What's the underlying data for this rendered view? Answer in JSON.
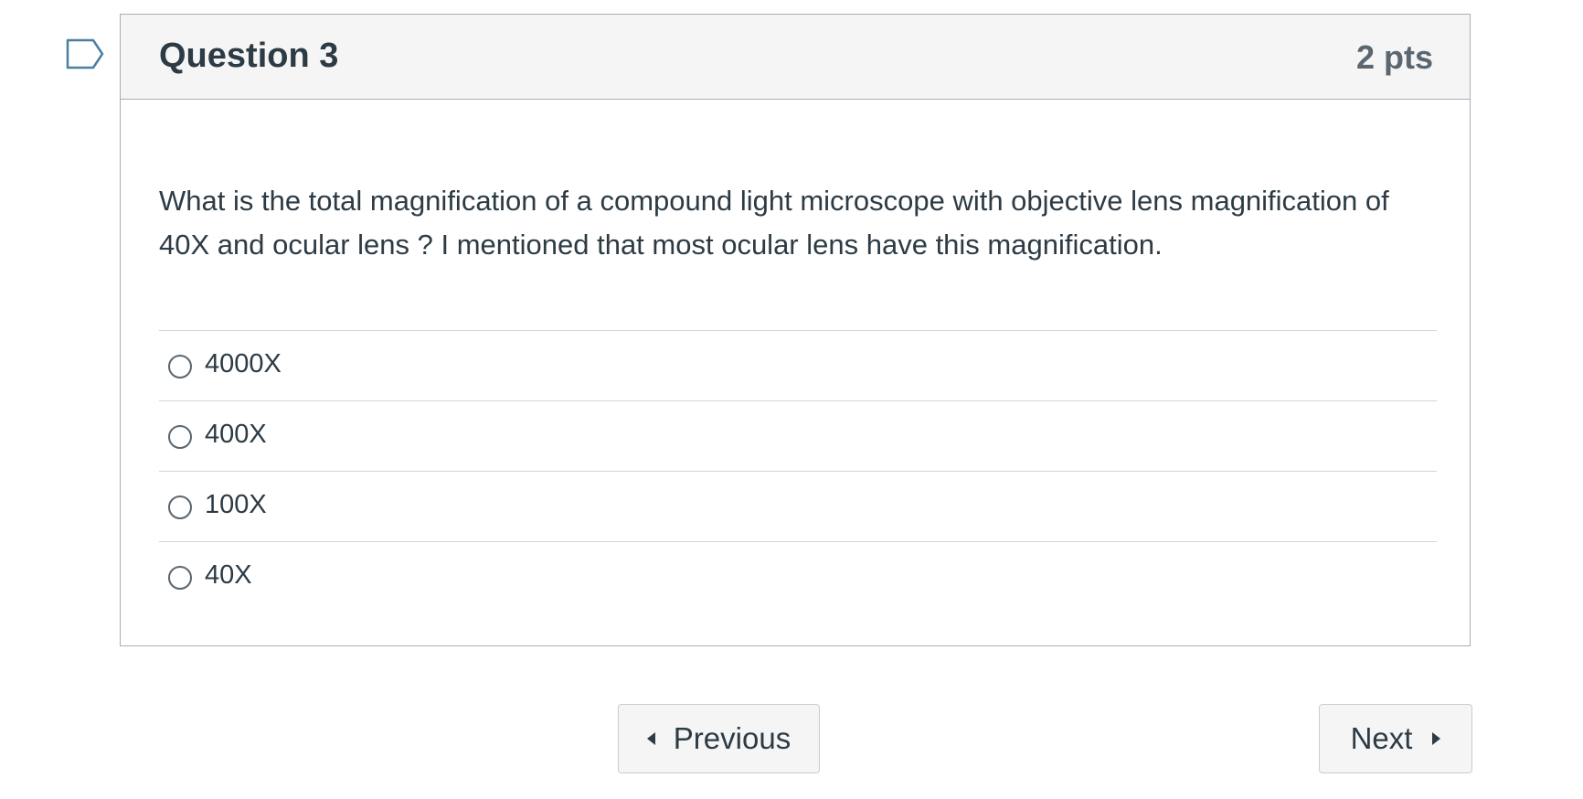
{
  "question": {
    "title": "Question 3",
    "points": "2 pts",
    "text": "What is the total magnification of a compound light microscope with objective lens magnification of 40X  and ocular lens ?  I mentioned that most ocular lens have this magnification.",
    "answers": [
      {
        "label": "4000X"
      },
      {
        "label": "400X"
      },
      {
        "label": "100X"
      },
      {
        "label": "40X"
      }
    ]
  },
  "navigation": {
    "previous_label": "Previous",
    "next_label": "Next"
  },
  "icons": {
    "flag": "flag-outline-icon",
    "previous": "caret-left-icon",
    "next": "caret-right-icon"
  },
  "colors": {
    "flag_stroke": "#4a7fa3",
    "header_bg": "#f5f5f5",
    "border": "#a5afb5",
    "text": "#2d3b45"
  }
}
